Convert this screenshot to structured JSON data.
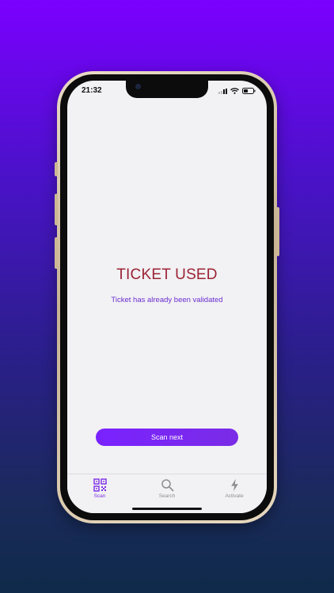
{
  "status_bar": {
    "time": "21:32"
  },
  "result": {
    "title": "TICKET USED",
    "message": "Ticket has already been validated",
    "title_color": "#9b2335",
    "message_color": "#6a2fd0"
  },
  "actions": {
    "scan_next_label": "Scan next"
  },
  "tab_bar": {
    "tabs": [
      {
        "label": "Scan",
        "icon": "qr-code-icon",
        "active": true
      },
      {
        "label": "Search",
        "icon": "search-icon",
        "active": false
      },
      {
        "label": "Activate",
        "icon": "lightning-bolt-icon",
        "active": false
      }
    ]
  },
  "colors": {
    "accent": "#7a2ce6",
    "inactive_tab": "#8e8e93",
    "background_gradient": [
      "#7b00ff",
      "#0f2a4a"
    ]
  }
}
